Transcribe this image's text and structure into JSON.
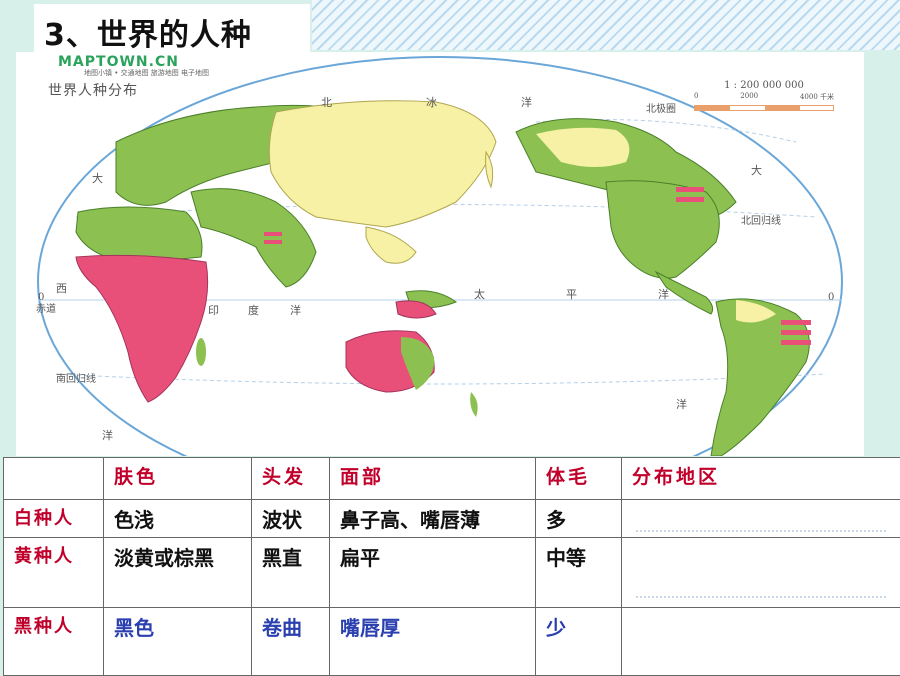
{
  "slide": {
    "title": "3、世界的人种"
  },
  "map": {
    "brand": "MAPTOWN.CN",
    "brand_sub": "地图小镇 • 交通地图 旅游地图 电子地图",
    "title": "世界人种分布",
    "scale": "1 : 200 000 000",
    "scale_ticks": [
      "0",
      "2000",
      "4000 千米"
    ],
    "labels": {
      "north": "北",
      "ice": "冰",
      "ocean1": "洋",
      "arctic_circle": "北极圈",
      "atlantic_da": "大",
      "pacific_da": "大",
      "tropic_cancer": "北回归线",
      "west": "西",
      "equator": "赤道",
      "india": "印",
      "du": "度",
      "ocean2": "洋",
      "tai": "太",
      "ping": "平",
      "ocean3": "洋",
      "zero_left": "0",
      "zero_right": "0",
      "tropic_capricorn": "南回归线",
      "ocean4": "洋",
      "ocean5": "洋"
    }
  },
  "table": {
    "headers": [
      "",
      "肤色",
      "头发",
      "面部",
      "体毛",
      "分布地区"
    ],
    "rows": [
      {
        "name": "白种人",
        "skin": "色浅",
        "hair": "波状",
        "face": "鼻子高、嘴唇薄",
        "body_hair": "多",
        "region": ""
      },
      {
        "name": "黄种人",
        "skin": "淡黄或棕黑",
        "hair": "黑直",
        "face": "扁平",
        "body_hair": "中等",
        "region": ""
      },
      {
        "name": "黑种人",
        "skin": "黑色",
        "hair": "卷曲",
        "face": "嘴唇厚",
        "body_hair": "少",
        "region": ""
      }
    ]
  },
  "colors": {
    "white_race": "#8cc152",
    "yellow_race": "#f6f1a4",
    "black_race": "#e8507a",
    "ocean": "#ffffff"
  }
}
